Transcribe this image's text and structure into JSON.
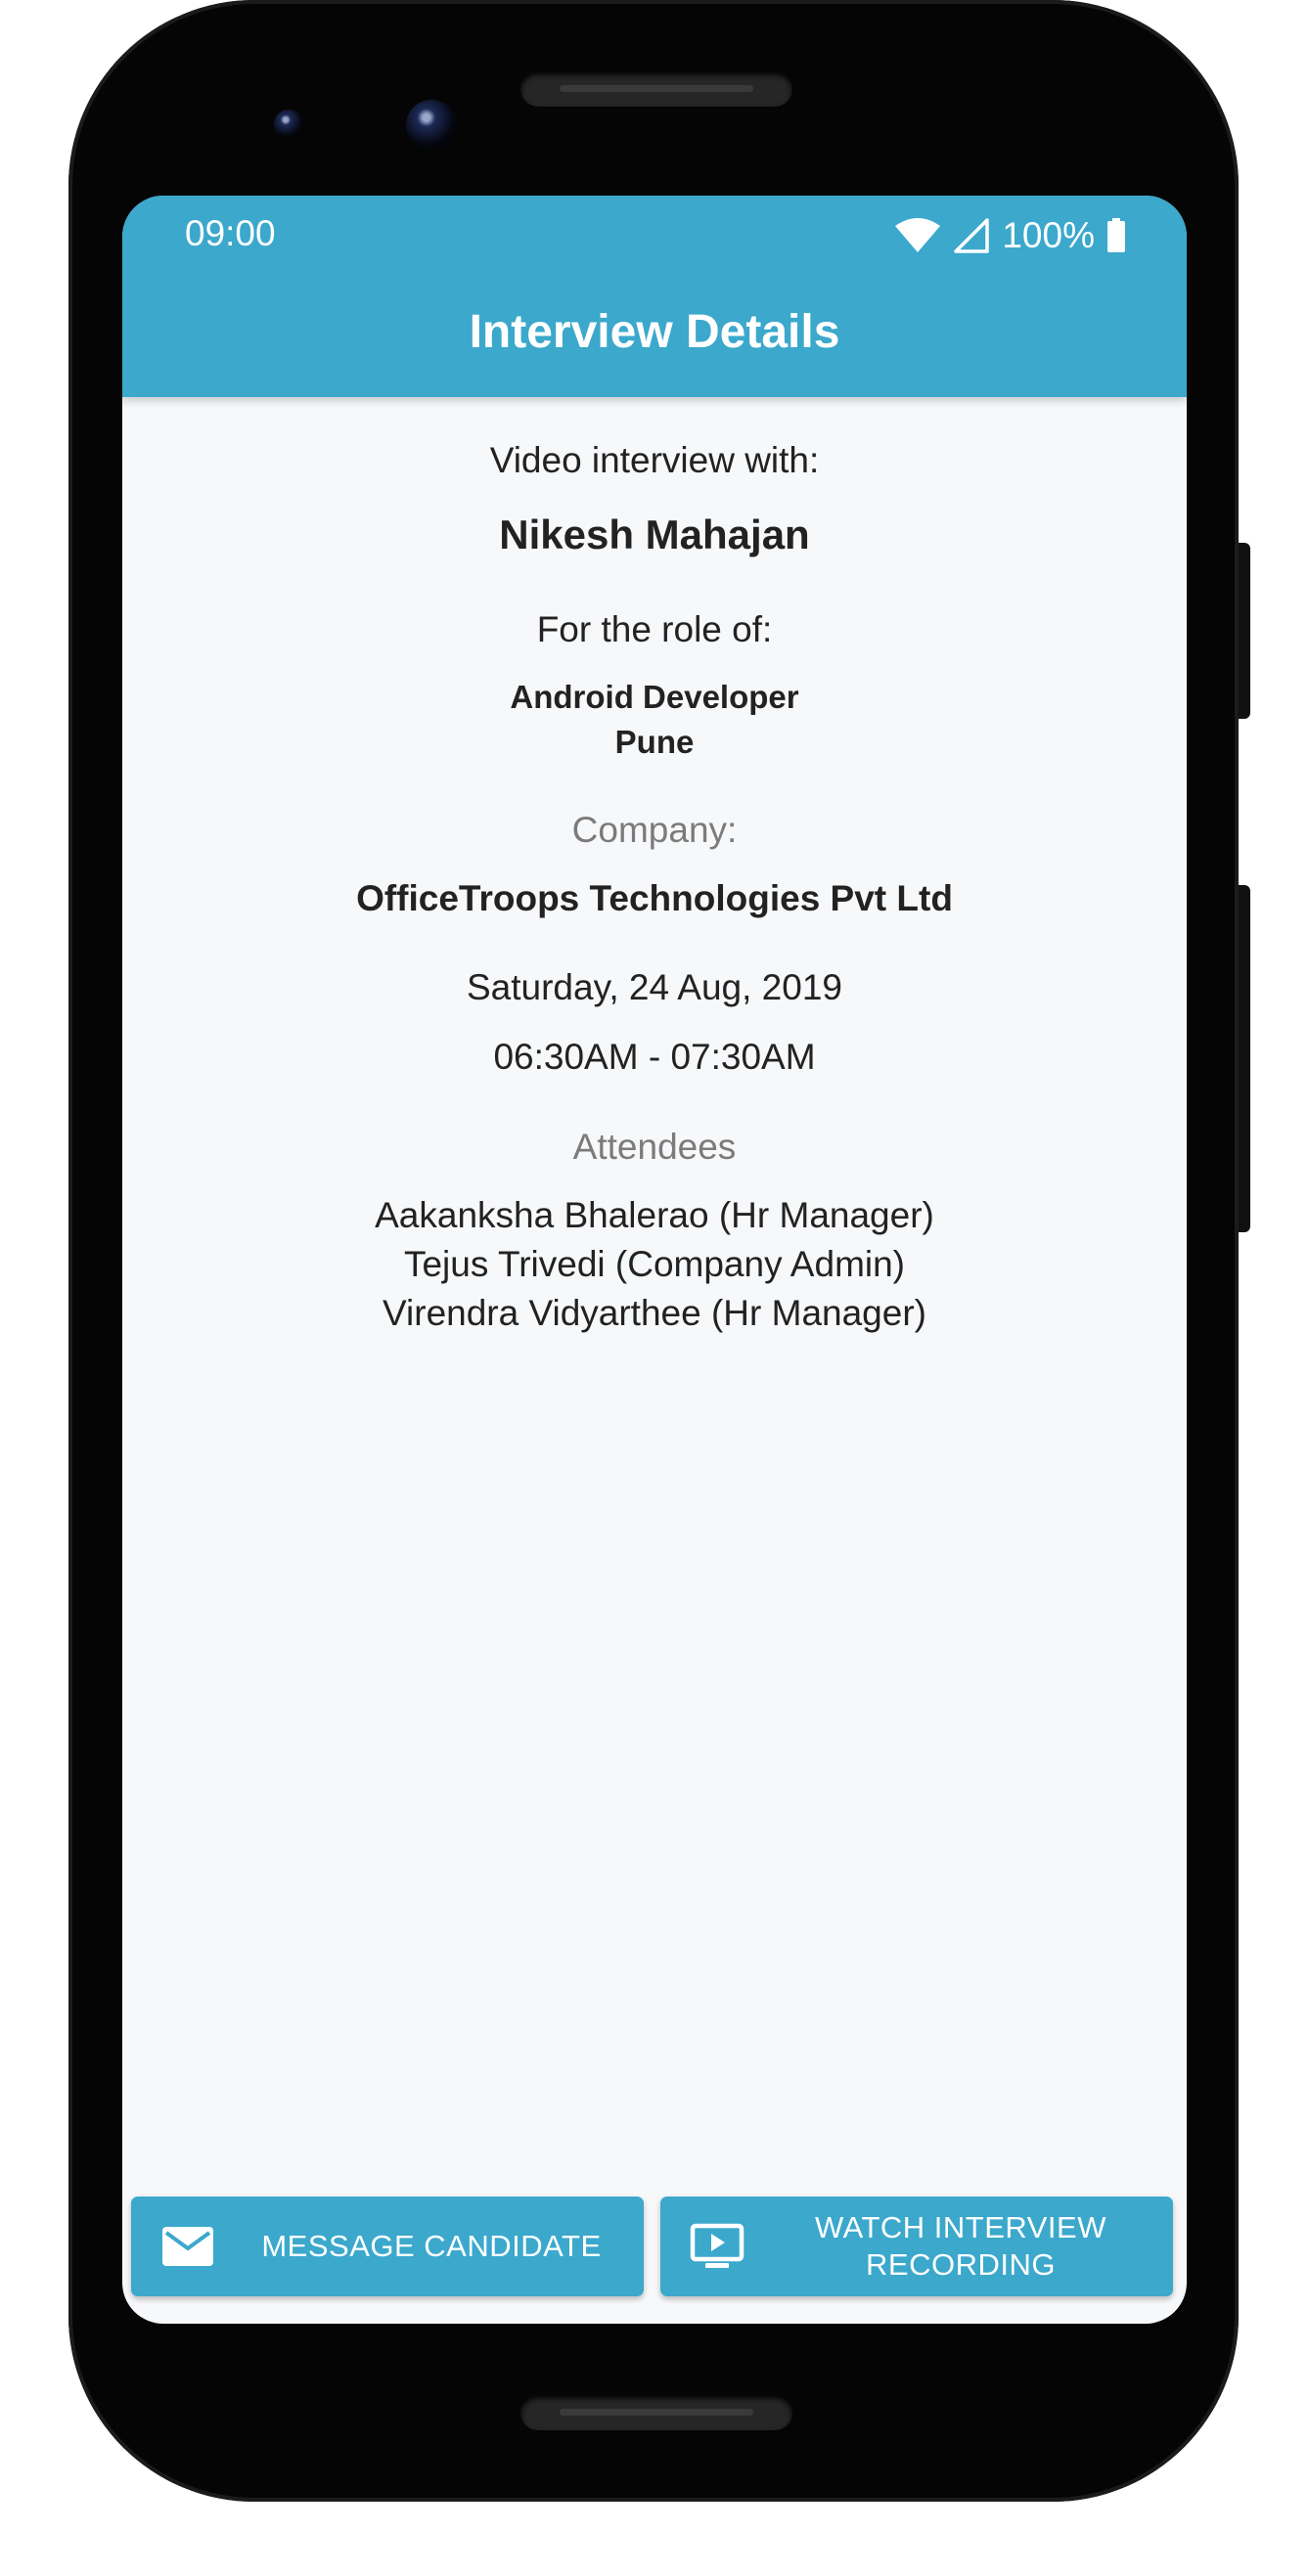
{
  "status_bar": {
    "time": "09:00",
    "battery": "100%",
    "icons": [
      "wifi-icon",
      "signal-icon",
      "battery-icon"
    ]
  },
  "app_bar": {
    "title": "Interview Details"
  },
  "details": {
    "intro": "Video interview with:",
    "candidate_name": "Nikesh Mahajan",
    "role_label": "For the role of:",
    "role": "Android Developer",
    "location": "Pune",
    "company_label": "Company:",
    "company": "OfficeTroops Technologies Pvt Ltd",
    "date": "Saturday, 24 Aug, 2019",
    "time": "06:30AM - 07:30AM",
    "attendees_label": "Attendees",
    "attendees": [
      "Aakanksha Bhalerao (Hr Manager)",
      "Tejus Trivedi (Company Admin)",
      "Virendra Vidyarthee (Hr Manager)"
    ]
  },
  "actions": {
    "message": {
      "label": "MESSAGE CANDIDATE",
      "icon": "mail-icon"
    },
    "watch": {
      "label": "WATCH INTERVIEW RECORDING",
      "icon": "video-recording-icon"
    }
  },
  "colors": {
    "primary": "#3ba8cc",
    "background": "#f7f8fa",
    "text": "#222222",
    "muted_text": "#7b7b7b"
  }
}
